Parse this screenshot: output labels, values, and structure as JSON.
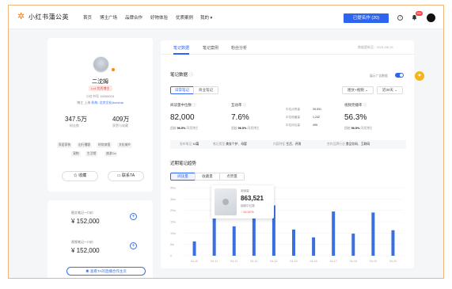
{
  "topnav": {
    "logo_text": "小红书蒲公英",
    "items": [
      "首页",
      "博主广场",
      "品牌合作",
      "好物体验",
      "优质案例",
      "我的 ▾"
    ],
    "publish_button": "已提名作 (20)",
    "help_icon": "question-circle-icon",
    "bell_icon": "bell-icon",
    "bell_badge": "99+"
  },
  "profile": {
    "name": "二沈姆",
    "level": "Lv4 优秀博主",
    "id_text": "小红书号 15000003",
    "location_label": "博主 上海",
    "location_link_label": "机构: 北京文化Aceshia",
    "stats": [
      {
        "value": "347.5万",
        "label": "粉丝数"
      },
      {
        "value": "409万",
        "label": "获赞与收藏"
      }
    ],
    "tags": [
      "家居家装",
      "出行播客",
      "时尚穿搭",
      "文化城乡",
      "宠物",
      "生活馆",
      "旅游Ca"
    ],
    "buttons": {
      "favorite": "收藏",
      "contact": "联系TA"
    }
  },
  "pricing": {
    "items": [
      {
        "label": "图文笔记一口价",
        "value": "¥ 152,000"
      },
      {
        "label": "视频笔记一口价",
        "value": "¥ 152,000"
      }
    ],
    "cta": "查看TA的直播合作主页"
  },
  "main": {
    "tabs": [
      "笔记数据",
      "笔记案例",
      "粉丝分析"
    ],
    "active_tab": 0,
    "update_time": "数据更新至：2021-08-19",
    "section_title": "笔记数据",
    "toggle_label": "展示广告数据",
    "toggle_on": true,
    "segments": [
      "日常笔记",
      "商业笔记"
    ],
    "dropdowns": [
      "图文+视频",
      "近30天"
    ],
    "metrics": [
      {
        "label": "阅读量中位数",
        "value": "82,000",
        "sub_label": "超越",
        "sub_value": "96.5%",
        "sub_tail": "同类博主"
      },
      {
        "label": "互动率",
        "value": "7.6%",
        "sub_label": "超越",
        "sub_value": "96.5%",
        "sub_tail": "同类博主"
      },
      {
        "label": "视频完播率",
        "value": "56.3%",
        "sub_label": "超越",
        "sub_value": "96.5%",
        "sub_tail": "同类博主"
      }
    ],
    "mini_stats": [
      {
        "label": "中位点赞量",
        "value": "39,531"
      },
      {
        "label": "中位收藏量",
        "value": "1,242"
      },
      {
        "label": "中位评论量",
        "value": "495"
      }
    ],
    "filter_bar": [
      {
        "label": "发布笔记",
        "value": "14篇"
      },
      {
        "label": "笔记类型",
        "value": "美妆个护、母婴"
      },
      {
        "label": "内容特征",
        "value": "生活、评测"
      },
      {
        "label": "合作品牌行业",
        "value": "食品饮料、互联网"
      }
    ],
    "trend_title": "近期笔记趋势",
    "trend_tabs": [
      "阅读量",
      "收藏量",
      "点赞量"
    ]
  },
  "chart_data": {
    "type": "bar",
    "categories": [
      "04-10",
      "04-11",
      "04-12",
      "04-13",
      "04-14",
      "04-15",
      "04-16",
      "04-17",
      "04-18",
      "04-19",
      "04-20"
    ],
    "values": [
      420000,
      1950000,
      863521,
      1250000,
      1480000,
      770000,
      540000,
      1300000,
      650000,
      1270000,
      750000
    ],
    "ytick_labels": [
      "40w",
      "30w",
      "20w",
      "15w",
      "10w",
      "5w",
      "0"
    ],
    "color": "#3a6fe0",
    "tooltip": {
      "label": "阅读量",
      "value": "863,521",
      "sub_label": "超越中位数",
      "pct": "↑ 34.02%"
    }
  },
  "fab_icon": "sparkle-icon"
}
